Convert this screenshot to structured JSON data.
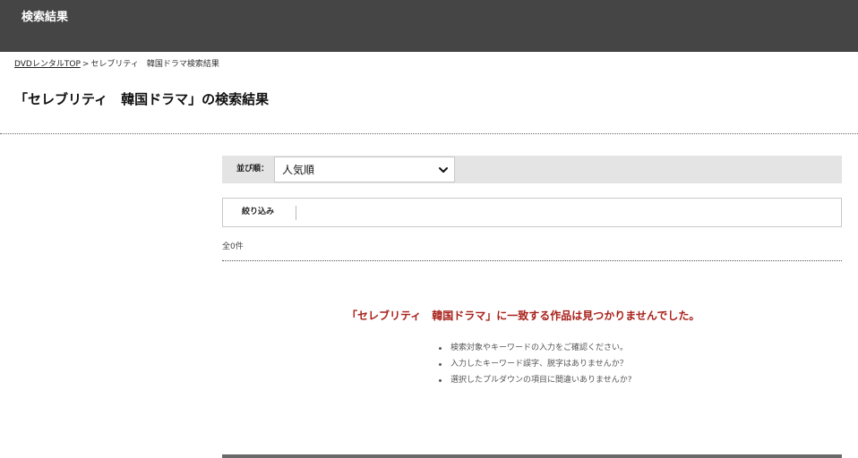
{
  "header": {
    "title": "検索結果"
  },
  "breadcrumb": {
    "home_link": "DVDレンタルTOP",
    "separator": ">",
    "current": "セレブリティ　韓国ドラマ検索結果"
  },
  "page": {
    "title": "「セレブリティ　韓国ドラマ」の検索結果"
  },
  "sort": {
    "label": "並び順：",
    "selected": "人気順",
    "icon": "chevron-down-icon"
  },
  "filter": {
    "label": "絞り込み"
  },
  "results": {
    "count_text": "全0件"
  },
  "no_results": {
    "message": "「セレブリティ　韓国ドラマ」に一致する作品は見つかりませんでした。",
    "hints": [
      "検索対象やキーワードの入力をご確認ください。",
      "入力したキーワード誤字、脱字はありませんか？",
      "選択したプルダウンの項目に間違いありませんか?"
    ]
  },
  "colors": {
    "header_bg": "#454545",
    "not_found_text": "#a8201a",
    "sort_bar_bg": "#e4e4e4"
  }
}
